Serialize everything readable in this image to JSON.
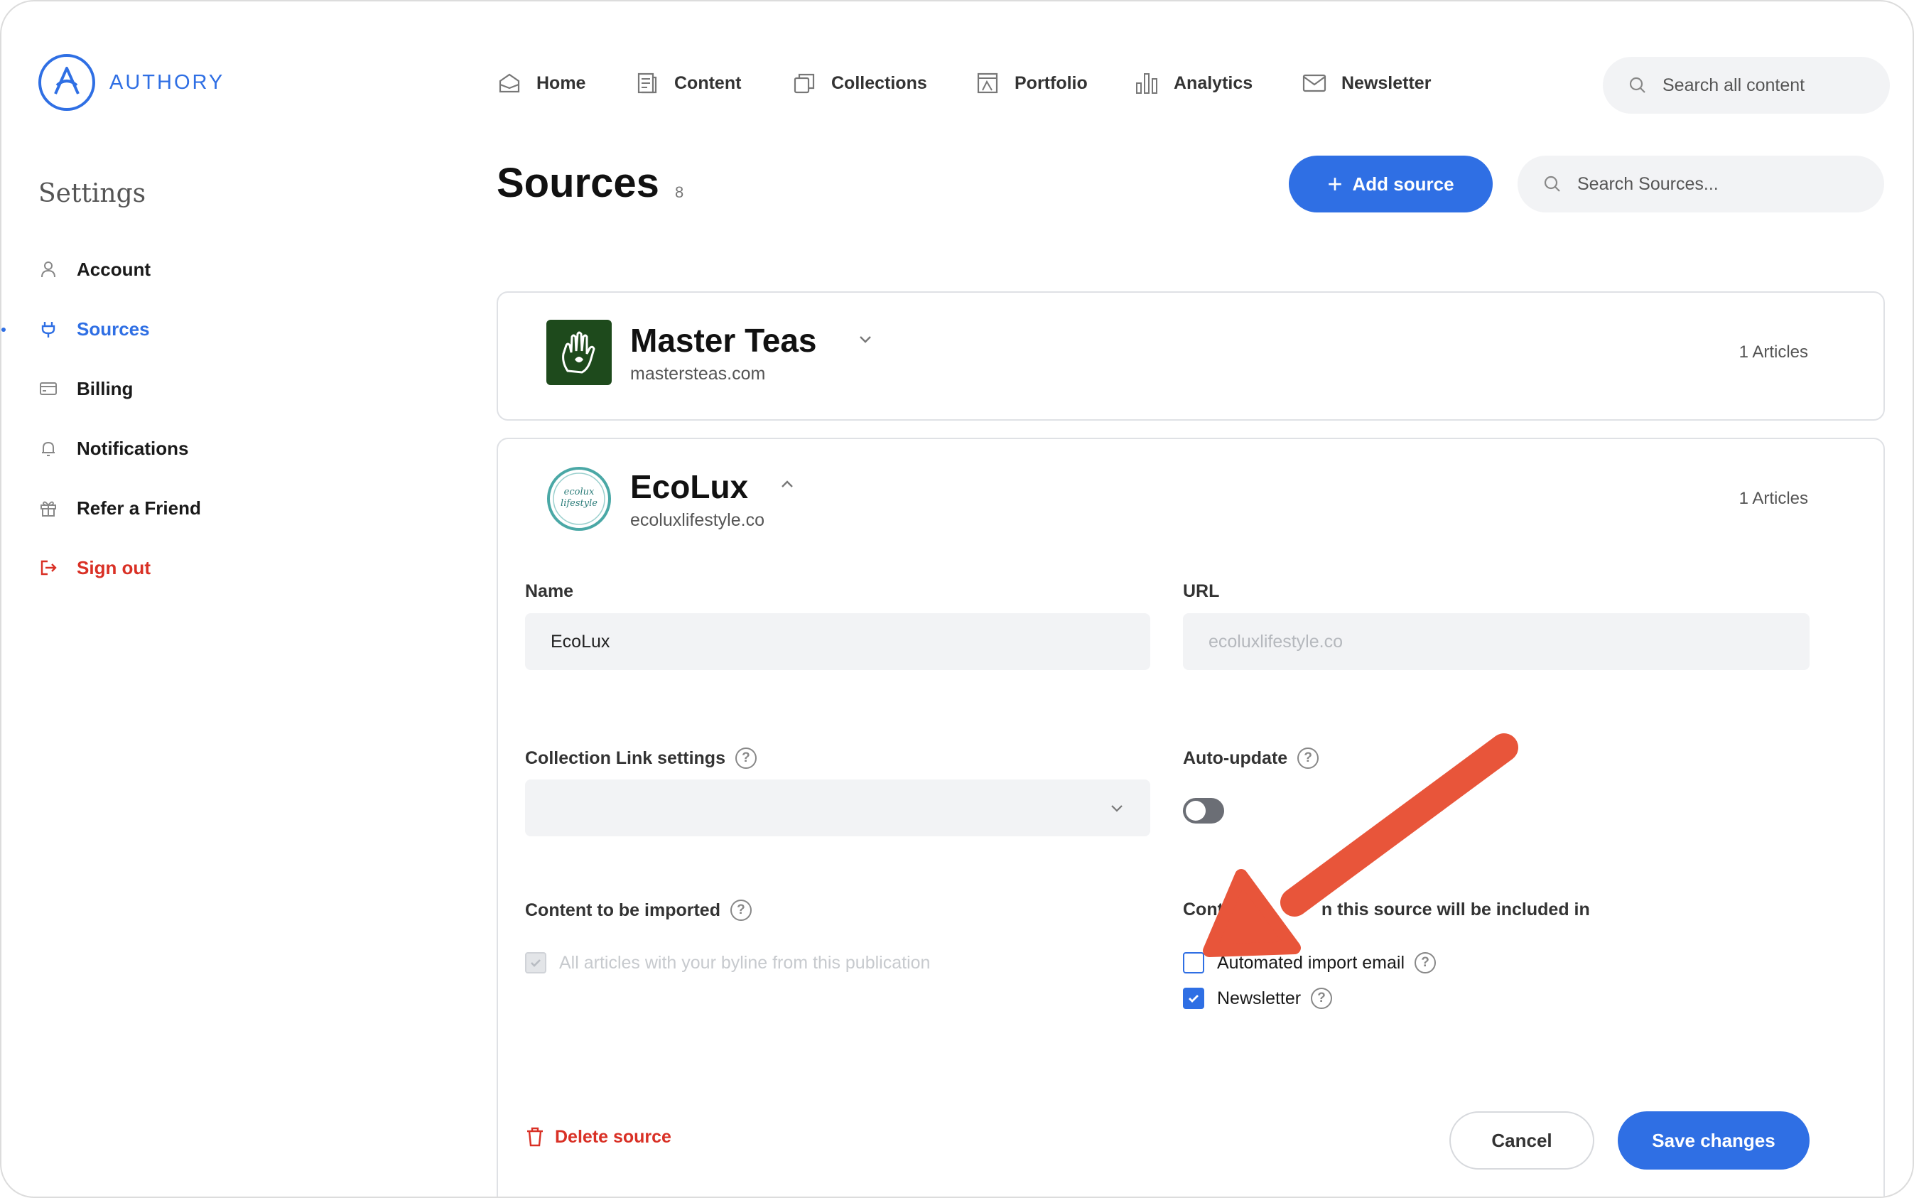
{
  "brand": {
    "name": "AUTHORY",
    "accent": "#2f6fe4",
    "danger": "#d93025",
    "annotation_arrow": "#e8553a"
  },
  "nav": {
    "items": [
      {
        "label": "Home",
        "icon": "home-icon"
      },
      {
        "label": "Content",
        "icon": "content-icon"
      },
      {
        "label": "Collections",
        "icon": "collections-icon"
      },
      {
        "label": "Portfolio",
        "icon": "portfolio-icon"
      },
      {
        "label": "Analytics",
        "icon": "analytics-icon"
      },
      {
        "label": "Newsletter",
        "icon": "mail-icon"
      }
    ],
    "search_placeholder": "Search all content"
  },
  "sidebar": {
    "title": "Settings",
    "items": [
      {
        "label": "Account",
        "icon": "user-icon"
      },
      {
        "label": "Sources",
        "icon": "plug-icon",
        "active": true
      },
      {
        "label": "Billing",
        "icon": "credit-card-icon"
      },
      {
        "label": "Notifications",
        "icon": "bell-icon"
      },
      {
        "label": "Refer a Friend",
        "icon": "gift-icon"
      },
      {
        "label": "Sign out",
        "icon": "sign-out-icon"
      }
    ]
  },
  "page": {
    "title": "Sources",
    "count": "8",
    "add_button": "Add source",
    "search_placeholder": "Search Sources..."
  },
  "sources": [
    {
      "name": "Master Teas",
      "url": "mastersteas.com",
      "articles": "1 Articles",
      "expanded": false
    },
    {
      "name": "EcoLux",
      "url": "ecoluxlifestyle.co",
      "articles": "1 Articles",
      "expanded": true
    }
  ],
  "form": {
    "name_label": "Name",
    "name_value": "EcoLux",
    "url_label": "URL",
    "url_value": "ecoluxlifestyle.co",
    "collection_label": "Collection Link settings",
    "collection_value": "",
    "autoupdate_label": "Auto-update",
    "autoupdate_on": false,
    "content_label": "Content to be imported",
    "content_option": "All articles with your byline from this publication",
    "included_label_prefix": "Cont",
    "included_label_suffix": "n this source will be included in",
    "options": [
      {
        "label": "Automated import email",
        "checked": false
      },
      {
        "label": "Newsletter",
        "checked": true
      }
    ],
    "delete_label": "Delete source",
    "cancel_label": "Cancel",
    "save_label": "Save changes"
  }
}
